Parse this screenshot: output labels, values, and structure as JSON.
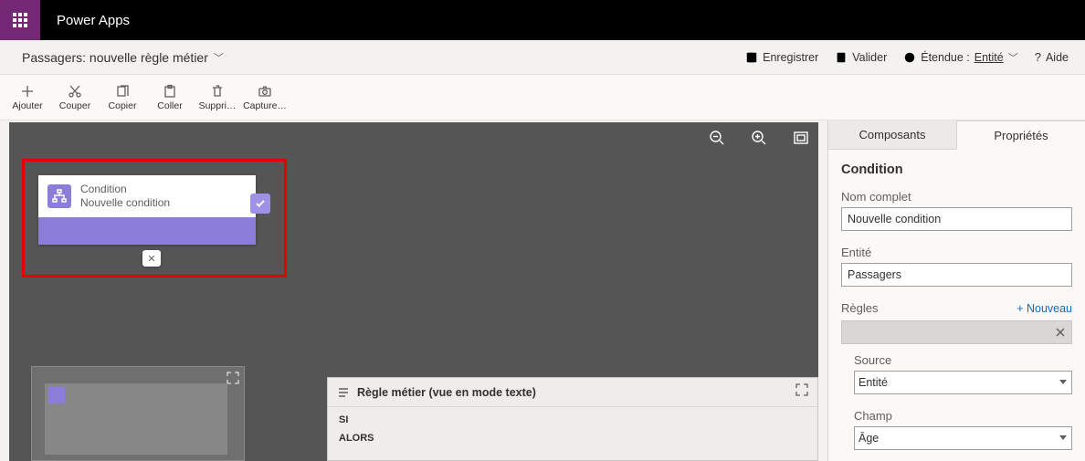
{
  "header": {
    "brand": "Power Apps"
  },
  "subheader": {
    "title": "Passagers: nouvelle règle métier",
    "actions": {
      "save": "Enregistrer",
      "validate": "Valider",
      "scope_label": "Étendue :",
      "scope_value": "Entité",
      "help": "Aide"
    }
  },
  "toolbar": {
    "add": "Ajouter",
    "cut": "Couper",
    "copy": "Copier",
    "paste": "Coller",
    "delete": "Suppri…",
    "snapshot": "Capture…"
  },
  "canvas": {
    "condition": {
      "title": "Condition",
      "subtitle": "Nouvelle condition"
    }
  },
  "textview": {
    "title": "Règle métier (vue en mode texte)",
    "if": "SI",
    "then": "ALORS"
  },
  "panel": {
    "tabs": {
      "components": "Composants",
      "properties": "Propriétés"
    },
    "section": "Condition",
    "displayName": {
      "label": "Nom complet",
      "value": "Nouvelle condition"
    },
    "entity": {
      "label": "Entité",
      "value": "Passagers"
    },
    "rules": {
      "label": "Règles",
      "new": "+  Nouveau"
    },
    "source": {
      "label": "Source",
      "value": "Entité"
    },
    "field": {
      "label": "Champ",
      "value": "Âge"
    }
  }
}
